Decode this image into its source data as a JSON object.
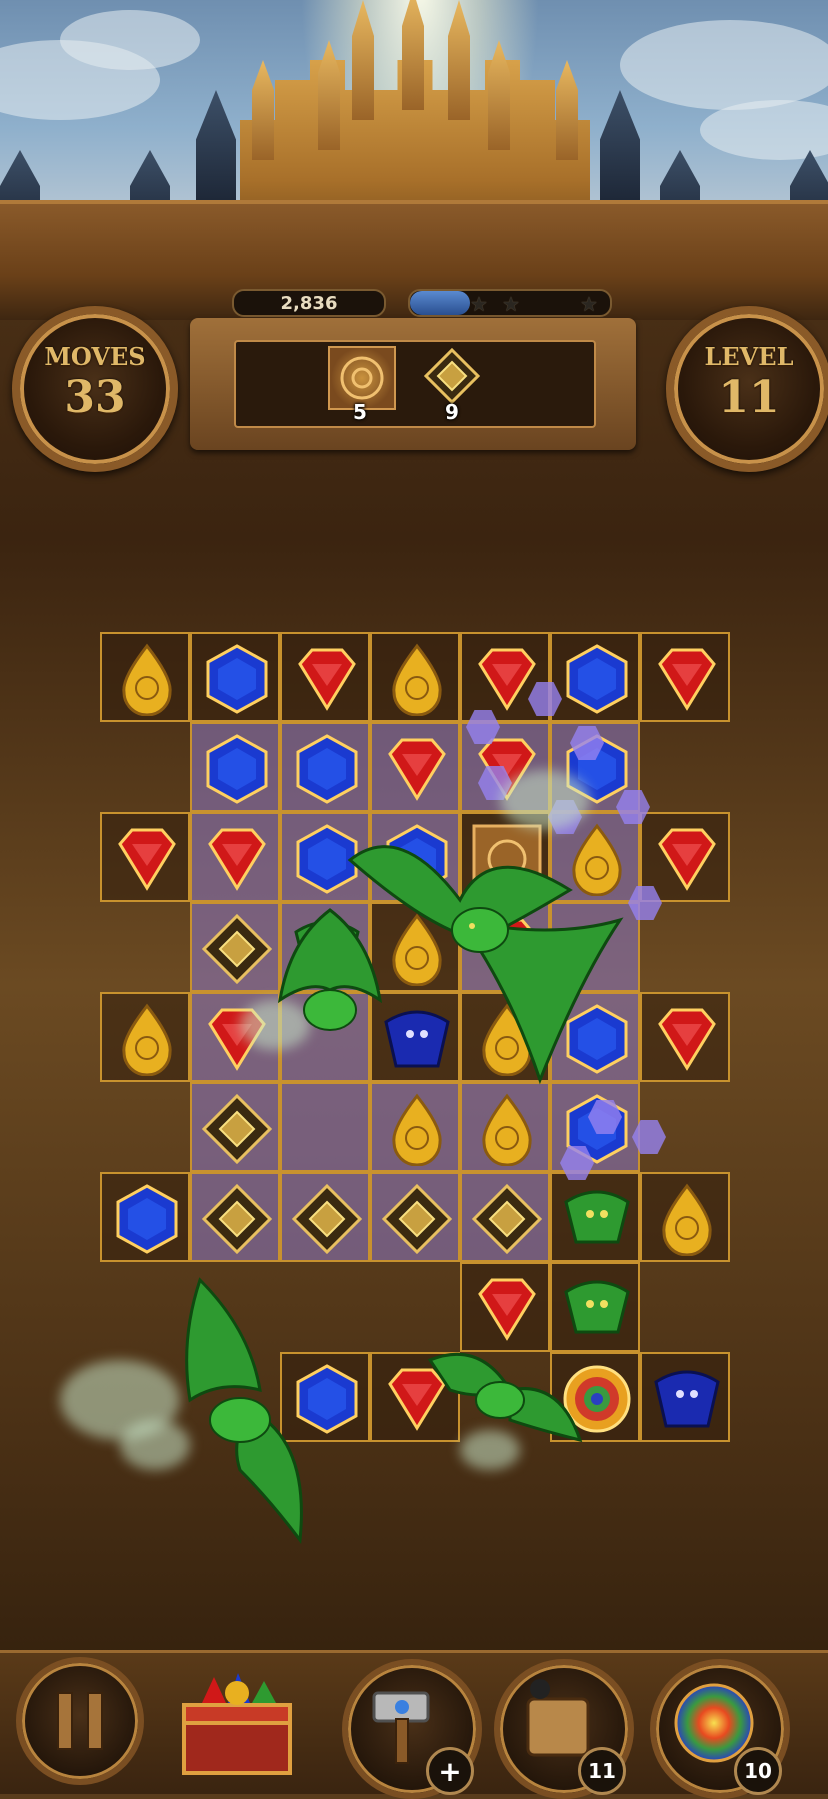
{
  "hud": {
    "score": "2,836",
    "star_progress": 0.3,
    "stars_earned": 0,
    "stars_total": 3,
    "moves_label": "MOVES",
    "moves_value": "33",
    "level_label": "LEVEL",
    "level_value": "11"
  },
  "goals": [
    {
      "icon": "sealed-tile-icon",
      "count": "5"
    },
    {
      "icon": "gold-diamond-block-icon",
      "count": "9"
    }
  ],
  "board": {
    "columns": 7,
    "rows": 9,
    "cells": [
      [
        "yellow-drop",
        "blue-hex",
        "red-gem",
        "yellow-drop",
        "red-gem",
        "blue-hex",
        "red-gem"
      ],
      [
        "",
        "blue-hex",
        "blue-hex",
        "red-gem",
        "red-gem",
        "blue-hex",
        ""
      ],
      [
        "red-gem",
        "red-gem",
        "blue-hex",
        "blue-hex",
        "wood-tile",
        "yellow-drop",
        "red-gem"
      ],
      [
        "",
        "gold-block",
        "green-gargoyle",
        "yellow-drop",
        "red-gem",
        "empty",
        ""
      ],
      [
        "yellow-drop",
        "red-gem",
        "empty",
        "blue-gargoyle",
        "yellow-drop",
        "blue-hex",
        "red-gem"
      ],
      [
        "",
        "gold-block",
        "empty",
        "yellow-drop",
        "yellow-drop",
        "blue-hex",
        ""
      ],
      [
        "blue-hex",
        "gold-block",
        "gold-block",
        "gold-block",
        "gold-block",
        "green-gargoyle",
        "yellow-drop"
      ],
      [
        "",
        "",
        "",
        "",
        "red-gem",
        "green-gargoyle",
        ""
      ],
      [
        "",
        "",
        "blue-hex",
        "red-gem",
        "",
        "rainbow-orb",
        "blue-gargoyle"
      ]
    ],
    "purple_cells": [
      [
        1,
        1
      ],
      [
        1,
        2
      ],
      [
        1,
        3
      ],
      [
        1,
        4
      ],
      [
        1,
        5
      ],
      [
        2,
        1
      ],
      [
        2,
        2
      ],
      [
        2,
        3
      ],
      [
        2,
        5
      ],
      [
        3,
        1
      ],
      [
        3,
        2
      ],
      [
        3,
        4
      ],
      [
        3,
        5
      ],
      [
        4,
        1
      ],
      [
        4,
        2
      ],
      [
        4,
        5
      ],
      [
        5,
        1
      ],
      [
        5,
        2
      ],
      [
        5,
        3
      ],
      [
        5,
        4
      ],
      [
        5,
        5
      ],
      [
        6,
        1
      ],
      [
        6,
        2
      ],
      [
        6,
        3
      ],
      [
        6,
        4
      ]
    ]
  },
  "toolbar": {
    "pause_icon": "pause-icon",
    "chest_icon": "treasure-chest-icon",
    "hammer_icon": "hammer-booster-icon",
    "bomb_icon": "bomb-booster-icon",
    "bomb_count": "11",
    "orb_icon": "rainbow-orb-booster-icon",
    "orb_count": "10"
  },
  "colors": {
    "gold": "#c8922e",
    "red": "#d01818",
    "blue": "#1a3ad0",
    "yellow": "#e8b020",
    "purple_tile": "#8c78c8",
    "green_dragon": "#2e9a30"
  }
}
